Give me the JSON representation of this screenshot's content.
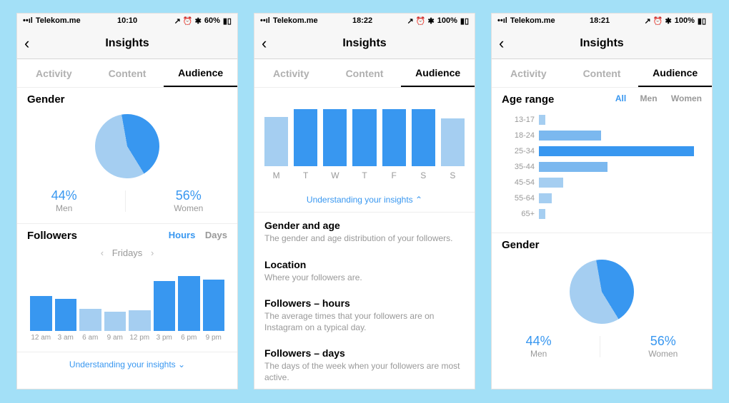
{
  "accent": "#3897f0",
  "accent_light": "#a5cef1",
  "phone1": {
    "status": {
      "carrier": "Telekom.me",
      "time": "10:10",
      "battery": "60%",
      "icons": "↗ ⏰ ✱"
    },
    "title": "Insights",
    "tabs": [
      "Activity",
      "Content",
      "Audience"
    ],
    "active_tab": "Audience",
    "gender": {
      "title": "Gender",
      "men_pct": "44%",
      "men_label": "Men",
      "women_pct": "56%",
      "women_label": "Women"
    },
    "followers": {
      "title": "Followers",
      "toggle": [
        "Hours",
        "Days"
      ],
      "active_toggle": "Hours",
      "day": "Fridays",
      "labels": [
        "12 am",
        "3 am",
        "6 am",
        "9 am",
        "12 pm",
        "3 pm",
        "6 pm",
        "9 pm"
      ]
    },
    "understanding": "Understanding your insights ⌄"
  },
  "phone2": {
    "status": {
      "carrier": "Telekom.me",
      "time": "18:22",
      "battery": "100%",
      "icons": "↗ ⏰ ✱"
    },
    "title": "Insights",
    "tabs": [
      "Activity",
      "Content",
      "Audience"
    ],
    "active_tab": "Audience",
    "week_labels": [
      "M",
      "T",
      "W",
      "T",
      "F",
      "S",
      "S"
    ],
    "understanding": "Understanding your insights ⌃",
    "info": [
      {
        "title": "Gender and age",
        "desc": "The gender and age distribution of your followers."
      },
      {
        "title": "Location",
        "desc": "Where your followers are."
      },
      {
        "title": "Followers – hours",
        "desc": "The average times that your followers are on Instagram on a typical day."
      },
      {
        "title": "Followers – days",
        "desc": "The days of the week when your followers are most active."
      }
    ]
  },
  "phone3": {
    "status": {
      "carrier": "Telekom.me",
      "time": "18:21",
      "battery": "100%",
      "icons": "↗ ⏰ ✱"
    },
    "title": "Insights",
    "tabs": [
      "Activity",
      "Content",
      "Audience"
    ],
    "active_tab": "Audience",
    "age": {
      "title": "Age range",
      "filters": [
        "All",
        "Men",
        "Women"
      ],
      "active_filter": "All",
      "labels": [
        "13-17",
        "18-24",
        "25-34",
        "35-44",
        "45-54",
        "55-64",
        "65+"
      ]
    },
    "gender": {
      "title": "Gender",
      "men_pct": "44%",
      "men_label": "Men",
      "women_pct": "56%",
      "women_label": "Women"
    }
  },
  "chart_data": [
    {
      "type": "pie",
      "title": "Gender",
      "series": [
        {
          "name": "Men",
          "value": 44
        },
        {
          "name": "Women",
          "value": 56
        }
      ],
      "colors": [
        "#3897f0",
        "#a5cef1"
      ]
    },
    {
      "type": "bar",
      "title": "Followers – Hours (Fridays)",
      "categories": [
        "12 am",
        "3 am",
        "6 am",
        "9 am",
        "12 pm",
        "3 pm",
        "6 pm",
        "9 pm"
      ],
      "values": [
        55,
        50,
        35,
        30,
        32,
        78,
        86,
        80
      ],
      "ylabel": "",
      "xlabel": ""
    },
    {
      "type": "bar",
      "title": "Followers – Days",
      "categories": [
        "M",
        "T",
        "W",
        "T",
        "F",
        "S",
        "S"
      ],
      "values": [
        86,
        100,
        100,
        100,
        100,
        100,
        84
      ],
      "ylabel": "",
      "xlabel": ""
    },
    {
      "type": "bar",
      "orientation": "horizontal",
      "title": "Age range",
      "categories": [
        "13-17",
        "18-24",
        "25-34",
        "35-44",
        "45-54",
        "55-64",
        "65+"
      ],
      "values": [
        4,
        38,
        95,
        42,
        15,
        8,
        4
      ],
      "ylabel": "",
      "xlabel": ""
    },
    {
      "type": "pie",
      "title": "Gender",
      "series": [
        {
          "name": "Men",
          "value": 44
        },
        {
          "name": "Women",
          "value": 56
        }
      ],
      "colors": [
        "#3897f0",
        "#a5cef1"
      ]
    }
  ]
}
